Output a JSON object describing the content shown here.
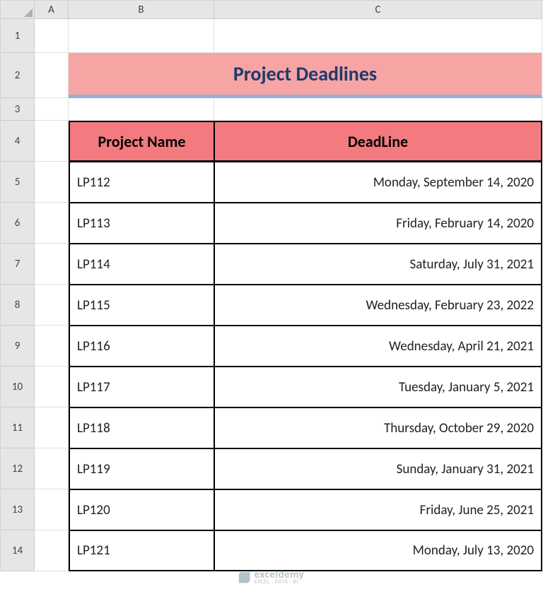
{
  "columns": [
    "A",
    "B",
    "C"
  ],
  "rows": [
    "1",
    "2",
    "3",
    "4",
    "5",
    "6",
    "7",
    "8",
    "9",
    "10",
    "11",
    "12",
    "13",
    "14"
  ],
  "title": "Project Deadlines",
  "headers": {
    "name": "Project Name",
    "deadline": "DeadLine"
  },
  "data": [
    {
      "name": "LP112",
      "deadline": "Monday, September 14, 2020"
    },
    {
      "name": "LP113",
      "deadline": "Friday, February 14, 2020"
    },
    {
      "name": "LP114",
      "deadline": "Saturday, July 31, 2021"
    },
    {
      "name": "LP115",
      "deadline": "Wednesday, February 23, 2022"
    },
    {
      "name": "LP116",
      "deadline": "Wednesday, April 21, 2021"
    },
    {
      "name": "LP117",
      "deadline": "Tuesday, January 5, 2021"
    },
    {
      "name": "LP118",
      "deadline": "Thursday, October 29, 2020"
    },
    {
      "name": "LP119",
      "deadline": "Sunday, January 31, 2021"
    },
    {
      "name": "LP120",
      "deadline": "Friday, June 25, 2021"
    },
    {
      "name": "LP121",
      "deadline": "Monday, July 13, 2020"
    }
  ],
  "watermark": {
    "brand": "exceldemy",
    "sub": "EXCEL · DATA · BI"
  }
}
